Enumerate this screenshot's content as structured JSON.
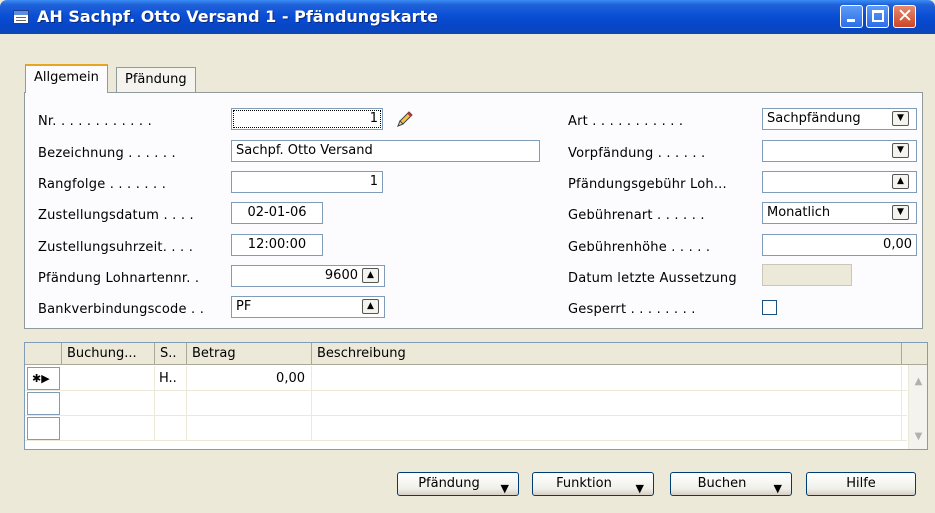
{
  "window": {
    "title": "AH Sachpf. Otto Versand 1 - Pfändungskarte",
    "controls": {
      "minimize": "_",
      "maximize": "□",
      "close": "✕"
    }
  },
  "tabs": [
    {
      "label": "Allgemein",
      "active": true
    },
    {
      "label": "Pfändung",
      "active": false
    }
  ],
  "form_left": {
    "nr": {
      "label": "Nr. . . . . . . . . . . .",
      "value": "1"
    },
    "bezeichnung": {
      "label": "Bezeichnung . . . . . .",
      "value": "Sachpf. Otto Versand"
    },
    "rangfolge": {
      "label": "Rangfolge . . . . . . .",
      "value": "1"
    },
    "zustellungsdatum": {
      "label": "Zustellungsdatum . . . .",
      "value": "02-01-06"
    },
    "zustellungsuhrzeit": {
      "label": "Zustellungsuhrzeit. . . .",
      "value": "12:00:00"
    },
    "pfaendung_lohnartennr": {
      "label": "Pfändung Lohnartennr. .",
      "value": "9600"
    },
    "bankverbindungscode": {
      "label": "Bankverbindungscode . .",
      "value": "PF"
    }
  },
  "form_right": {
    "art": {
      "label": "Art . . . . . . . . . . .",
      "value": "Sachpfändung"
    },
    "vorpfaendung": {
      "label": "Vorpfändung . . . . . .",
      "value": ""
    },
    "pfaendungsgebuehr_loh": {
      "label": "Pfändungsgebühr Loh...",
      "value": ""
    },
    "gebuehrenart": {
      "label": "Gebührenart . . . . . .",
      "value": "Monatlich"
    },
    "gebuehrenhoehe": {
      "label": "Gebührenhöhe . . . . .",
      "value": "0,00"
    },
    "datum_letzte_aussetzung": {
      "label": "Datum letzte Aussetzung",
      "value": ""
    },
    "gesperrt": {
      "label": "Gesperrt . . . . . . . .",
      "checked": false
    }
  },
  "grid": {
    "columns": [
      "Buchung...",
      "S..",
      "Betrag",
      "Beschreibung"
    ],
    "rows": [
      {
        "marker": "✱▶",
        "buchung": "",
        "s": "H..",
        "betrag": "0,00",
        "beschreibung": ""
      },
      {
        "marker": "",
        "buchung": "",
        "s": "",
        "betrag": "",
        "beschreibung": ""
      },
      {
        "marker": "",
        "buchung": "",
        "s": "",
        "betrag": "",
        "beschreibung": ""
      }
    ]
  },
  "buttons": {
    "pfaendung": "Pfändung",
    "funktion": "Funktion",
    "buchen": "Buchen",
    "hilfe": "Hilfe"
  },
  "icons": {
    "dropdown": "▼",
    "lookup": "▲",
    "scroll_up": "▲",
    "scroll_down": "▼",
    "pencil": "pencil-icon"
  }
}
